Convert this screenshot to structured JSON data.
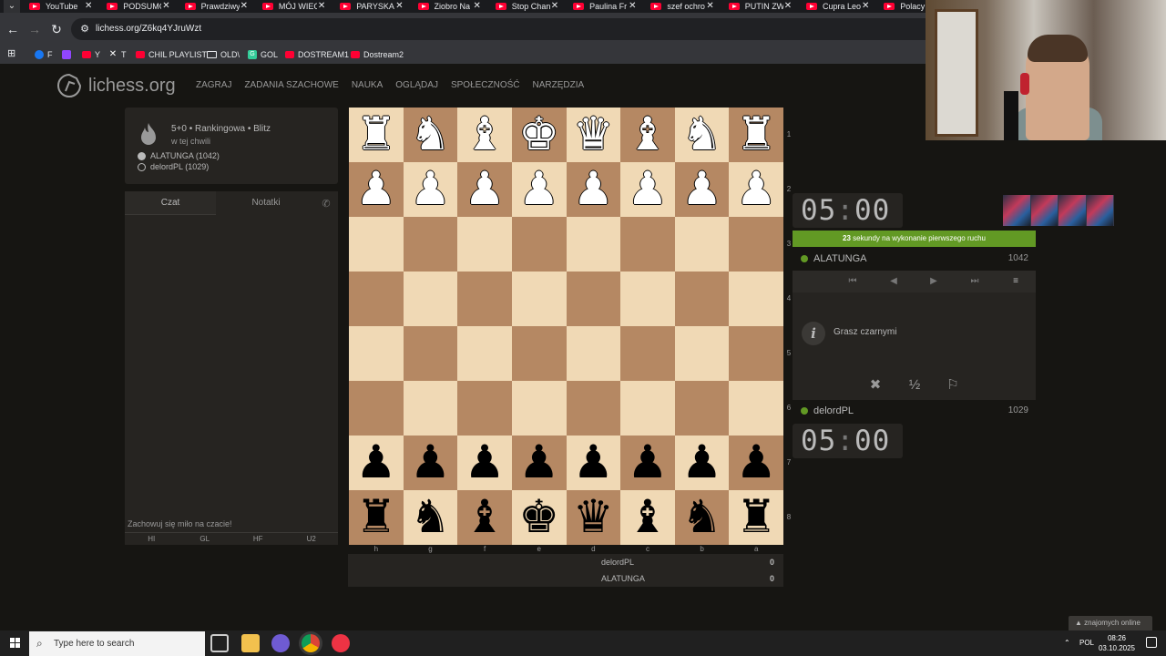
{
  "browser": {
    "tabs": [
      "YouTube",
      "PODSUMC",
      "Prawdziwy",
      "MÓJ WIEC",
      "PARYSKA",
      "Ziobro Na",
      "Stop Chan",
      "Paulina Fr",
      "szef ochro",
      "PUTIN ZW",
      "Cupra Leo",
      "Polacy W"
    ],
    "url": "lichess.org/Z6kq4YJruWzt",
    "bookmarks": [
      "F",
      "Y",
      "T",
      "CHIL PLAYLIST",
      "OLD\\",
      "GOL",
      "DOSTREAM1",
      "Dostream2"
    ]
  },
  "site": {
    "logo": "lichess.org",
    "nav": [
      "ZAGRAJ",
      "ZADANIA SZACHOWE",
      "NAUKA",
      "OGLĄDAJ",
      "SPOŁECZNOŚĆ",
      "NARZĘDZIA"
    ]
  },
  "game": {
    "setup": "5+0 • Rankingowa • Blitz",
    "time": "w tej chwili",
    "player_white": "ALATUNGA (1042)",
    "player_black": "delordPL (1029)"
  },
  "chat": {
    "tab_chat": "Czat",
    "tab_notes": "Notatki",
    "placeholder": "Zachowuj się miło na czacie!",
    "presets": [
      "HI",
      "GL",
      "HF",
      "U2"
    ]
  },
  "board": {
    "ranks": [
      "1",
      "2",
      "3",
      "4",
      "5",
      "6",
      "7",
      "8"
    ],
    "files": [
      "h",
      "g",
      "f",
      "e",
      "d",
      "c",
      "b",
      "a"
    ],
    "rows": [
      [
        "♜",
        "♞",
        "♝",
        "♚",
        "♛",
        "♝",
        "♞",
        "♜"
      ],
      [
        "♟",
        "♟",
        "♟",
        "♟",
        "♟",
        "♟",
        "♟",
        "♟"
      ],
      [
        "",
        "",
        "",
        "",
        "",
        "",
        "",
        ""
      ],
      [
        "",
        "",
        "",
        "",
        "",
        "",
        "",
        ""
      ],
      [
        "",
        "",
        "",
        "",
        "",
        "",
        "",
        ""
      ],
      [
        "",
        "",
        "",
        "",
        "",
        "",
        "",
        ""
      ],
      [
        "♟",
        "♟",
        "♟",
        "♟",
        "♟",
        "♟",
        "♟",
        "♟"
      ],
      [
        "♜",
        "♞",
        "♝",
        "♚",
        "♛",
        "♝",
        "♞",
        "♜"
      ]
    ],
    "colors": [
      "w",
      "w",
      "",
      "",
      "",
      "",
      "b",
      "b"
    ]
  },
  "score": {
    "rows": [
      {
        "name": "delordPL",
        "value": "0"
      },
      {
        "name": "ALATUNGA",
        "value": "0"
      }
    ]
  },
  "panel": {
    "clock_top_min": "05",
    "clock_top_sec": "00",
    "clock_bottom_min": "05",
    "clock_bottom_sec": "00",
    "firstmove_seconds": "23",
    "firstmove_text": " sekundy na wykonanie pierwszego ruchu",
    "top_player": "ALATUNGA",
    "top_rating": "1042",
    "bottom_player": "delordPL",
    "bottom_rating": "1029",
    "info": "Grasz czarnymi",
    "actions": [
      "✖",
      "½",
      "⚐"
    ]
  },
  "friends": "znajomych online",
  "taskbar": {
    "search": "Type here to search",
    "lang": "POL",
    "time": "08:26",
    "date": "03.10.2025"
  },
  "colors": {
    "light_square": "#f0d9b5",
    "dark_square": "#b58863",
    "accent_green": "#629924",
    "background": "#161512"
  }
}
